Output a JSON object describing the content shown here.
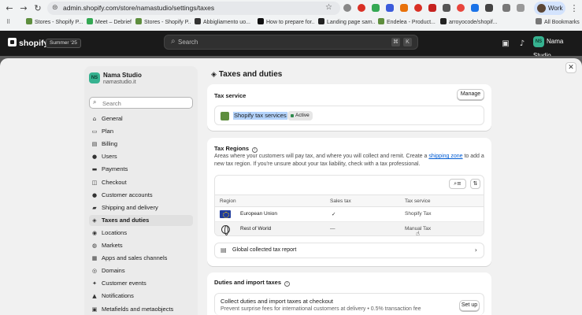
{
  "browser": {
    "url": "admin.shopify.com/store/namastudio/settings/taxes",
    "profile_label": "Work",
    "bookmarks": [
      {
        "label": "Stores - Shopify P...",
        "color": "#5e8e3e"
      },
      {
        "label": "Meet – Debrief",
        "color": "#34a853"
      },
      {
        "label": "Stores - Shopify P...",
        "color": "#5e8e3e"
      },
      {
        "label": "Abbigliamento uo...",
        "color": "#333333"
      },
      {
        "label": "How to prepare for...",
        "color": "#111111"
      },
      {
        "label": "Landing page sam...",
        "color": "#222222"
      },
      {
        "label": "Endelea - Product...",
        "color": "#5e8e3e"
      },
      {
        "label": "arroyocode/shopif...",
        "color": "#222222"
      }
    ],
    "all_bookmarks_label": "All Bookmarks"
  },
  "topbar": {
    "logo_text": "shopify",
    "edition_badge": "Summer '25",
    "search_placeholder": "Search",
    "shortcut_keys": [
      "⌘",
      "K"
    ],
    "store_initials": "NS",
    "store_name": "Nama Studio"
  },
  "sidebar": {
    "store_initials": "NS",
    "store_name": "Nama Studio",
    "store_domain": "namastudio.it",
    "search_placeholder": "Search",
    "items": [
      {
        "label": "General",
        "icon": "store-icon",
        "glyph": "⌂"
      },
      {
        "label": "Plan",
        "icon": "plan-icon",
        "glyph": "▭"
      },
      {
        "label": "Billing",
        "icon": "billing-icon",
        "glyph": "▤"
      },
      {
        "label": "Users",
        "icon": "users-icon",
        "glyph": "●"
      },
      {
        "label": "Payments",
        "icon": "payments-icon",
        "glyph": "▬"
      },
      {
        "label": "Checkout",
        "icon": "checkout-icon",
        "glyph": "◫"
      },
      {
        "label": "Customer accounts",
        "icon": "customer-accounts-icon",
        "glyph": "●"
      },
      {
        "label": "Shipping and delivery",
        "icon": "truck-icon",
        "glyph": "▰"
      },
      {
        "label": "Taxes and duties",
        "icon": "tax-icon",
        "glyph": "◈"
      },
      {
        "label": "Locations",
        "icon": "location-icon",
        "glyph": "◉"
      },
      {
        "label": "Markets",
        "icon": "globe-icon",
        "glyph": "◍"
      },
      {
        "label": "Apps and sales channels",
        "icon": "apps-icon",
        "glyph": "▦"
      },
      {
        "label": "Domains",
        "icon": "domains-icon",
        "glyph": "◎"
      },
      {
        "label": "Customer events",
        "icon": "events-icon",
        "glyph": "✦"
      },
      {
        "label": "Notifications",
        "icon": "bell-icon",
        "glyph": "▲"
      },
      {
        "label": "Metafields and metaobjects",
        "icon": "metafields-icon",
        "glyph": "▣"
      }
    ],
    "active_index": 8
  },
  "page": {
    "title": "Taxes and duties",
    "tax_service": {
      "title": "Tax service",
      "manage_label": "Manage",
      "service_name": "Shopify tax services",
      "status": "Active"
    },
    "tax_regions": {
      "title": "Tax Regions",
      "desc_before": "Areas where your customers will pay tax, and where you will collect and remit. Create a ",
      "desc_link": "shipping zone",
      "desc_after": " to add a new tax region. If you're unsure about your tax liability, check with a tax professional.",
      "columns": [
        "Region",
        "Sales tax",
        "Tax service"
      ],
      "rows": [
        {
          "region": "European Union",
          "sales_tax": "✓",
          "tax_service": "Shopify Tax",
          "flag": "eu-flag-icon"
        },
        {
          "region": "Rest of World",
          "sales_tax": "—",
          "tax_service": "Manual Tax",
          "flag": "globe-icon"
        }
      ],
      "global_report_label": "Global collected tax report"
    },
    "duties": {
      "title": "Duties and import taxes",
      "collect_title": "Collect duties and import taxes at checkout",
      "collect_desc": "Prevent surprise fees for international customers at delivery • 0.5% transaction fee",
      "setup_label": "Set up"
    }
  },
  "colors": {
    "topbar": "#1a1a1a",
    "accent_link": "#005bd3",
    "store_avatar": "#36b290",
    "selection_highlight": "#b3d3fc"
  }
}
